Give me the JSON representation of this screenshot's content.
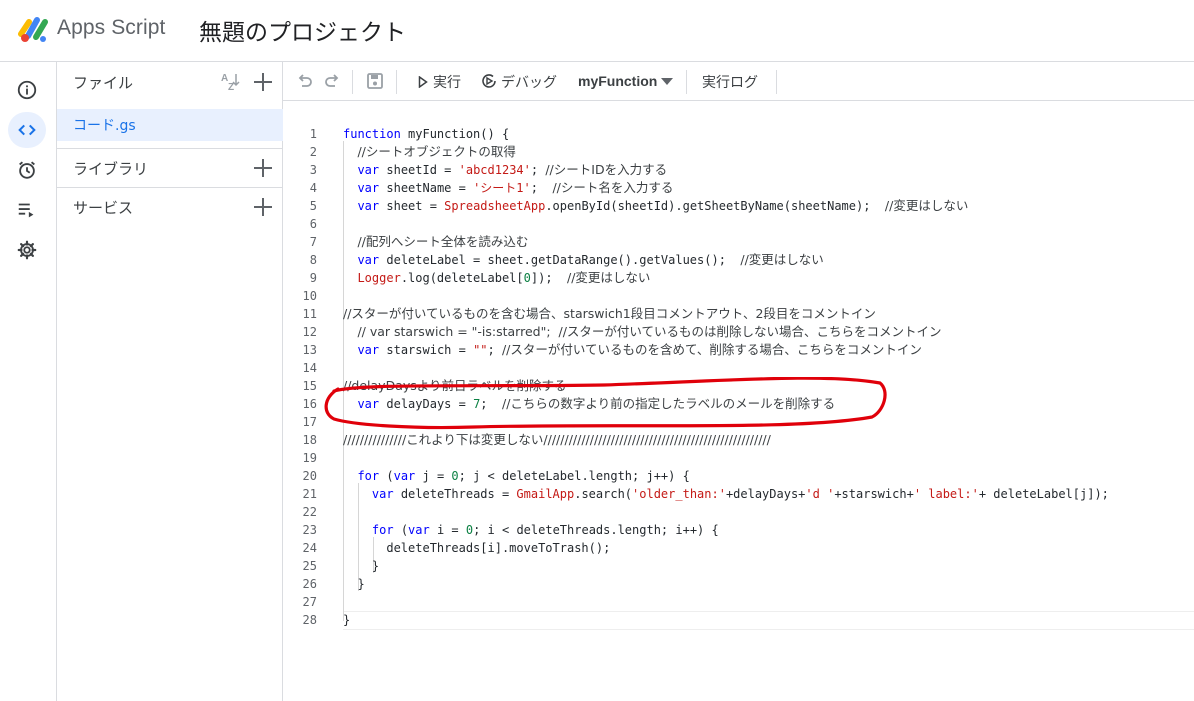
{
  "header": {
    "app_name": "Apps Script",
    "project_title": "無題のプロジェクト"
  },
  "rail": {
    "items": [
      {
        "name": "overview",
        "icon": "info-icon"
      },
      {
        "name": "editor",
        "icon": "code-icon",
        "active": true
      },
      {
        "name": "triggers",
        "icon": "alarm-icon"
      },
      {
        "name": "executions",
        "icon": "executions-icon"
      },
      {
        "name": "settings",
        "icon": "gear-icon"
      }
    ]
  },
  "files": {
    "title": "ファイル",
    "items": [
      {
        "name": "コード.gs"
      }
    ],
    "libraries_label": "ライブラリ",
    "services_label": "サービス"
  },
  "toolbar": {
    "run_label": "実行",
    "debug_label": "デバッグ",
    "function_name": "myFunction",
    "log_label": "実行ログ"
  },
  "colors": {
    "accent": "#1a73e8",
    "active_bg": "#e8f0fe",
    "keyword": "#0000ff",
    "string": "#c41a16",
    "annotation": "#e0000a"
  },
  "code": {
    "line_numbers": [
      "1",
      "2",
      "3",
      "4",
      "5",
      "6",
      "7",
      "8",
      "9",
      "10",
      "11",
      "12",
      "13",
      "14",
      "15",
      "16",
      "17",
      "18",
      "19",
      "20",
      "21",
      "22",
      "23",
      "24",
      "25",
      "26",
      "27",
      "28"
    ],
    "lines": [
      [
        {
          "t": "function",
          "c": "kw"
        },
        {
          "t": " myFunction() {"
        }
      ],
      [
        {
          "t": "  "
        },
        {
          "t": "//シートオブジェクトの取得",
          "c": "cmt"
        }
      ],
      [
        {
          "t": "  "
        },
        {
          "t": "var",
          "c": "kw"
        },
        {
          "t": " sheetId = "
        },
        {
          "t": "'abcd1234'",
          "c": "str"
        },
        {
          "t": "; "
        },
        {
          "t": "//シートIDを入力する",
          "c": "cmt"
        }
      ],
      [
        {
          "t": "  "
        },
        {
          "t": "var",
          "c": "kw"
        },
        {
          "t": " sheetName = "
        },
        {
          "t": "'シート1'",
          "c": "str"
        },
        {
          "t": ";  "
        },
        {
          "t": "//シート名を入力する",
          "c": "cmt"
        }
      ],
      [
        {
          "t": "  "
        },
        {
          "t": "var",
          "c": "kw"
        },
        {
          "t": " sheet = "
        },
        {
          "t": "SpreadsheetApp",
          "c": "cls"
        },
        {
          "t": ".openById(sheetId).getSheetByName(sheetName);  "
        },
        {
          "t": "//変更はしない",
          "c": "cmt"
        }
      ],
      [],
      [
        {
          "t": "  "
        },
        {
          "t": "//配列へシート全体を読み込む",
          "c": "cmt"
        }
      ],
      [
        {
          "t": "  "
        },
        {
          "t": "var",
          "c": "kw"
        },
        {
          "t": " deleteLabel = sheet.getDataRange().getValues();  "
        },
        {
          "t": "//変更はしない",
          "c": "cmt"
        }
      ],
      [
        {
          "t": "  "
        },
        {
          "t": "Logger",
          "c": "cls"
        },
        {
          "t": ".log(deleteLabel["
        },
        {
          "t": "0",
          "c": "num"
        },
        {
          "t": "]);  "
        },
        {
          "t": "//変更はしない",
          "c": "cmt"
        }
      ],
      [],
      [
        {
          "t": "//スターが付いているものを含む場合、starswich1段目コメントアウト、2段目をコメントイン",
          "c": "cmt"
        }
      ],
      [
        {
          "t": "  "
        },
        {
          "t": "// var starswich = \"-is:starred\";  //スターが付いているものは削除しない場合、こちらをコメントイン",
          "c": "cmt"
        }
      ],
      [
        {
          "t": "  "
        },
        {
          "t": "var",
          "c": "kw"
        },
        {
          "t": " starswich = "
        },
        {
          "t": "\"\"",
          "c": "str"
        },
        {
          "t": "; "
        },
        {
          "t": "//スターが付いているものを含めて、削除する場合、こちらをコメントイン",
          "c": "cmt"
        }
      ],
      [],
      [
        {
          "t": "//delayDaysより前日ラベルを削除する",
          "c": "cmt"
        }
      ],
      [
        {
          "t": "  "
        },
        {
          "t": "var",
          "c": "kw"
        },
        {
          "t": " delayDays = "
        },
        {
          "t": "7",
          "c": "num"
        },
        {
          "t": ";  "
        },
        {
          "t": "//こちらの数字より前の指定したラベルのメールを削除する",
          "c": "cmt"
        }
      ],
      [],
      [
        {
          "t": "///////////////これより下は変更しない//////////////////////////////////////////////////////",
          "c": "cmt"
        }
      ],
      [],
      [
        {
          "t": "  "
        },
        {
          "t": "for",
          "c": "kw"
        },
        {
          "t": " ("
        },
        {
          "t": "var",
          "c": "kw"
        },
        {
          "t": " j = "
        },
        {
          "t": "0",
          "c": "num"
        },
        {
          "t": "; j < deleteLabel.length; j++) {"
        }
      ],
      [
        {
          "t": "    "
        },
        {
          "t": "var",
          "c": "kw"
        },
        {
          "t": " deleteThreads = "
        },
        {
          "t": "GmailApp",
          "c": "cls"
        },
        {
          "t": ".search("
        },
        {
          "t": "'older_than:'",
          "c": "str"
        },
        {
          "t": "+delayDays+"
        },
        {
          "t": "'d '",
          "c": "str"
        },
        {
          "t": "+starswich+"
        },
        {
          "t": "' label:'",
          "c": "str"
        },
        {
          "t": "+ deleteLabel[j]);"
        }
      ],
      [],
      [
        {
          "t": "    "
        },
        {
          "t": "for",
          "c": "kw"
        },
        {
          "t": " ("
        },
        {
          "t": "var",
          "c": "kw"
        },
        {
          "t": " i = "
        },
        {
          "t": "0",
          "c": "num"
        },
        {
          "t": "; i < deleteThreads.length; i++) {"
        }
      ],
      [
        {
          "t": "      deleteThreads[i].moveToTrash();"
        }
      ],
      [
        {
          "t": "    }"
        }
      ],
      [
        {
          "t": "  }"
        }
      ],
      [],
      [
        {
          "t": "}"
        }
      ]
    ]
  }
}
